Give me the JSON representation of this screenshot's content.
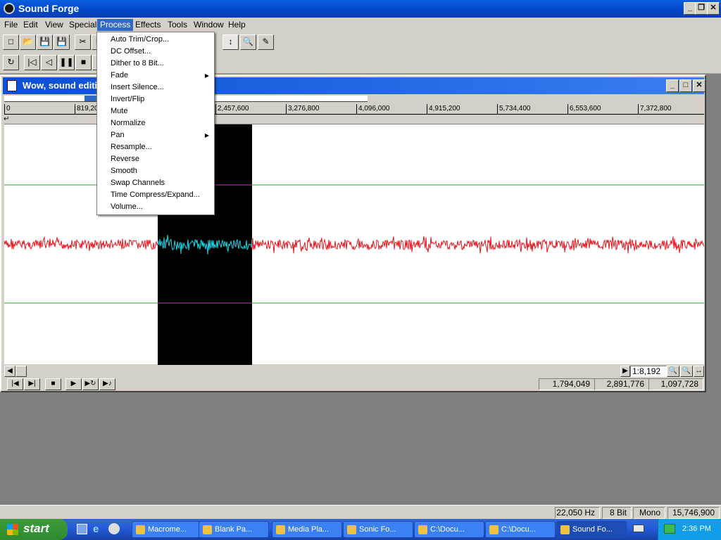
{
  "app": {
    "title": "Sound Forge",
    "min_label": "_",
    "restore_label": "❐",
    "close_label": "✕"
  },
  "menubar": [
    "File",
    "Edit",
    "View",
    "Special",
    "Process",
    "Effects",
    "Tools",
    "Window",
    "Help"
  ],
  "process_menu": {
    "items": [
      {
        "label": "Auto Trim/Crop...",
        "sub": false
      },
      {
        "label": "DC Offset...",
        "sub": false
      },
      {
        "label": "Dither to 8 Bit...",
        "sub": false
      },
      {
        "label": "Fade",
        "sub": true
      },
      {
        "label": "Insert Silence...",
        "sub": false
      },
      {
        "label": "Invert/Flip",
        "sub": false
      },
      {
        "label": "Mute",
        "sub": false
      },
      {
        "label": "Normalize",
        "sub": false
      },
      {
        "label": "Pan",
        "sub": true
      },
      {
        "label": "Resample...",
        "sub": false
      },
      {
        "label": "Reverse",
        "sub": false
      },
      {
        "label": "Smooth",
        "sub": false
      },
      {
        "label": "Swap Channels",
        "sub": false
      },
      {
        "label": "Time Compress/Expand...",
        "sub": false
      },
      {
        "label": "Volume...",
        "sub": false
      }
    ]
  },
  "child_window": {
    "title": "Wow, sound editi"
  },
  "ruler_labels": [
    "0",
    "819,200",
    "2,457,600",
    "3,276,800",
    "4,096,000",
    "4,915,200",
    "5,734,400",
    "6,553,600",
    "7,372,800"
  ],
  "zoom_ratio": "1:8,192",
  "selection": {
    "start": "1,794,049",
    "end": "2,891,776",
    "length": "1,097,728"
  },
  "statusbar": {
    "rate": "22,050 Hz",
    "bits": "8 Bit",
    "channels": "Mono",
    "samples": "15,746,900"
  },
  "taskbar": {
    "start_label": "start",
    "tasks": [
      "Macrome...",
      "Blank Pa...",
      "Media Pla...",
      "Sonic Fo...",
      "C:\\Docu...",
      "C:\\Docu...",
      "Sound Fo..."
    ],
    "active_task_index": 6,
    "clock": "2:36 PM"
  },
  "colors": {
    "waveform": "#e8141c",
    "selected_waveform": "#19d6e6",
    "selection_bg": "#000000",
    "guide": "#1fa82a"
  }
}
